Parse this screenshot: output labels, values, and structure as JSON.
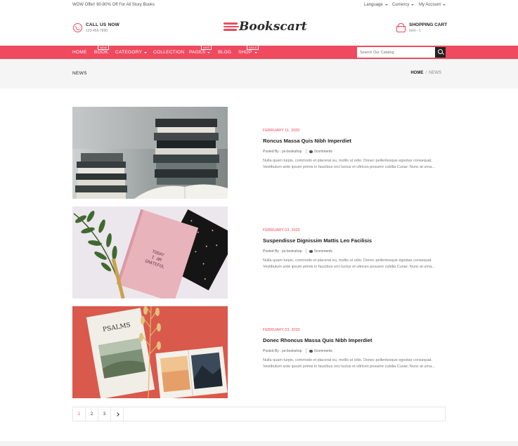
{
  "topbar": {
    "promo": "WOW Offer! 60-80% Off For All Story Books",
    "language": "Language",
    "currency": "Currency",
    "account": "My Account"
  },
  "header": {
    "call_title": "CALL US NOW",
    "call_phone": "123-456-7890",
    "logo_text": "Bookscart",
    "cart_title": "SHOPPING CART",
    "cart_items": "Item - 1"
  },
  "nav": {
    "items": [
      {
        "label": "HOME"
      },
      {
        "label": "BOOK",
        "badge": "NEW"
      },
      {
        "label": "CATEGORY"
      },
      {
        "label": "COLLECTION"
      },
      {
        "label": "PAGES",
        "badge": "HOT"
      },
      {
        "label": "BLOG"
      },
      {
        "label": "SHOP",
        "badge": "SALE"
      }
    ],
    "search_placeholder": "Search Our Catalog"
  },
  "crumbbar": {
    "title": "NEWS",
    "home": "HOME",
    "sep": "/",
    "current": "NEWS"
  },
  "posts": [
    {
      "date": "FEBRUARY 11, 2020",
      "title": "Roncus Massa Quis Nibh Imperdiet",
      "author": "Posted By : ps-bookshop",
      "comments": "0comments",
      "excerpt": "Nulla quam turpis, commodo et placerat eu, mollis ut odio. Donec pellentesque egestas consequat. Vestibulum ante ipsum primis in faucibus orci luctus et ultrices posuere cubilia Curae; Nunc at urna..."
    },
    {
      "date": "FEBRUARY 03, 2020",
      "title": "Suspendisse Dignissim Mattis Leo Facilisis",
      "author": "Posted By : ps-bookshop",
      "comments": "0comments",
      "excerpt": "Nulla quam turpis, commodo et placerat eu, mollis ut odio. Donec pellentesque egestas consequat. Vestibulum ante ipsum primis in faucibus orci luctus et ultrices posuere cubilia Curae; Nunc at urna..."
    },
    {
      "date": "FEBRUARY 03, 2020",
      "title": "Donec Rhoncus Massa Quis Nibh Imperdiet",
      "author": "Posted By : ps-bookshop",
      "comments": "0comments",
      "excerpt": "Nulla quam turpis, commodo et placerat eu, mollis ut odio. Donec pellentesque egestas consequat. Vestibulum ante ipsum primis in faucibus orci luctus et ultrices posuere cubilia Curae; Nunc at urna..."
    }
  ],
  "image_text": {
    "journal_line1": "TODAY",
    "journal_line2": "I AM",
    "journal_line3": "GRATEFUL",
    "book_title": "PSALMS"
  },
  "pagination": {
    "pages": [
      "1",
      "2",
      "3"
    ],
    "active": "1"
  },
  "colors": {
    "accent": "#ef4a5f",
    "dark": "#222222"
  }
}
